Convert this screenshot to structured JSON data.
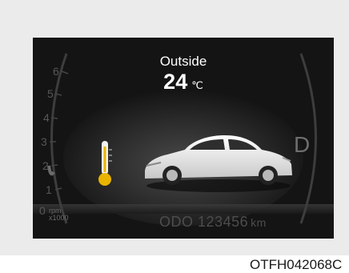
{
  "display": {
    "label": "Outside",
    "temperature": "24",
    "unit": "℃"
  },
  "gauge": {
    "tach_numbers": [
      "6",
      "5",
      "4",
      "3",
      "2",
      "1",
      "0"
    ],
    "tach_unit_line1": "rpm",
    "tach_unit_line2": "x1000",
    "gear": "D"
  },
  "odometer": {
    "label": "ODO",
    "value": "123456",
    "unit": "km"
  },
  "figure_code": "OTFH042068C",
  "icons": [
    "thermometer-icon",
    "car-icon"
  ],
  "colors": {
    "screen_bg": "#141414",
    "thermometer_bulb": "#e8b400",
    "car_body": "#f2f2f2"
  }
}
